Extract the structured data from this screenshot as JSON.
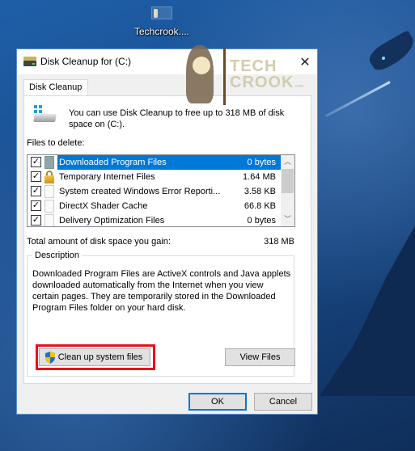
{
  "desktop": {
    "icon_label": "Techcrook...."
  },
  "watermark": {
    "line1": "TECH",
    "line2": "CROOK",
    "suffix": ".com"
  },
  "dialog": {
    "title": "Disk Cleanup for  (C:)",
    "tab": "Disk Cleanup",
    "intro": "You can use Disk Cleanup to free up to 318 MB of disk space on  (C:).",
    "files_label": "Files to delete:",
    "files": [
      {
        "name": "Downloaded Program Files",
        "size": "0 bytes",
        "checked": true,
        "selected": true,
        "icon": "folder-icon"
      },
      {
        "name": "Temporary Internet Files",
        "size": "1.64 MB",
        "checked": true,
        "selected": false,
        "icon": "lock-icon"
      },
      {
        "name": "System created Windows Error Reporti...",
        "size": "3.58 KB",
        "checked": true,
        "selected": false,
        "icon": "file-icon"
      },
      {
        "name": "DirectX Shader Cache",
        "size": "66.8 KB",
        "checked": true,
        "selected": false,
        "icon": "file-icon"
      },
      {
        "name": "Delivery Optimization Files",
        "size": "0 bytes",
        "checked": true,
        "selected": false,
        "icon": "file-icon"
      }
    ],
    "total_label": "Total amount of disk space you gain:",
    "total_value": "318 MB",
    "description_legend": "Description",
    "description_text": "Downloaded Program Files are ActiveX controls and Java applets downloaded automatically from the Internet when you view certain pages. They are temporarily stored in the Downloaded Program Files folder on your hard disk.",
    "cleanup_button": "Clean up system files",
    "view_files_button": "View Files",
    "ok_button": "OK",
    "cancel_button": "Cancel",
    "close_glyph": "✕"
  },
  "colors": {
    "selection": "#0078d7",
    "highlight_box": "#e8111b"
  }
}
